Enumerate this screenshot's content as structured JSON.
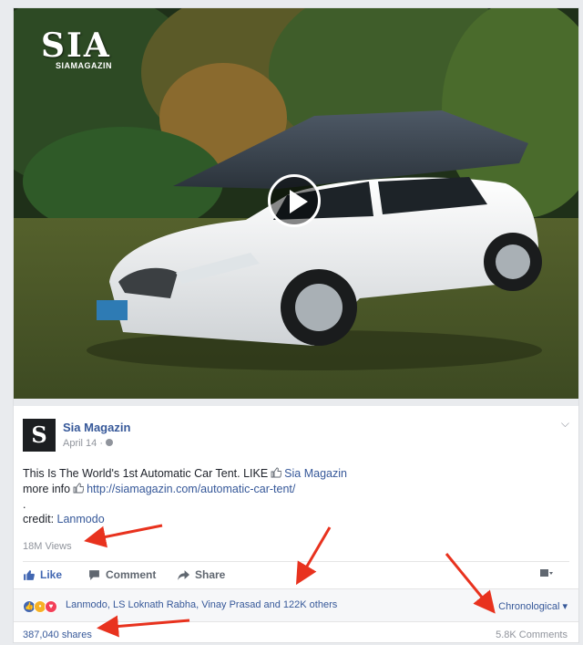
{
  "media": {
    "logo_main": "SIA",
    "logo_sub": "SIAMAGAZIN"
  },
  "post": {
    "page_name": "Sia Magazin",
    "avatar_letter": "S",
    "date": "April 14 ·",
    "line1_text": "This Is The World's 1st Automatic Car Tent. LIKE",
    "line1_link": "Sia Magazin",
    "line2_text": "more info",
    "line2_link": "http://siamagazin.com/automatic-car-tent/",
    "dot": ".",
    "credit_label": "credit:",
    "credit_link": "Lanmodo",
    "views": "18M Views"
  },
  "actions": {
    "like": "Like",
    "comment": "Comment",
    "share": "Share"
  },
  "reactions": {
    "summary": "Lanmodo, LS Loknath Rabha, Vinay Prasad and 122K others",
    "sort": "Chronological"
  },
  "stats": {
    "shares": "387,040 shares",
    "comments": "5.8K Comments"
  },
  "colors": {
    "link": "#365899",
    "arrow": "#e8321e"
  }
}
